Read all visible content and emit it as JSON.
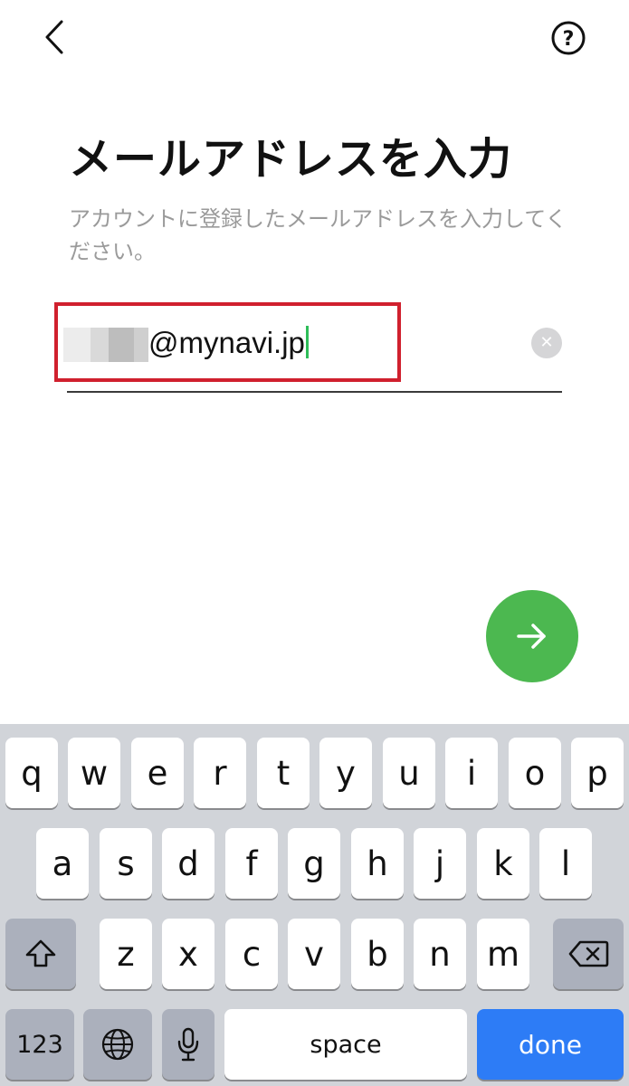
{
  "header": {
    "back_icon": "chevron-left-icon",
    "help_icon": "question-circle-icon",
    "help_glyph": "?"
  },
  "title": "メールアドレスを入力",
  "description": "アカウントに登録したメールアドレスを入力してください。",
  "email": {
    "value": "@mynavi.jp",
    "clear_icon": "clear-icon",
    "clear_glyph": "✕"
  },
  "next_button": {
    "icon": "arrow-right-icon"
  },
  "colors": {
    "accent_green": "#4cb850",
    "caret_green": "#2ebd59",
    "highlight_red": "#d0202e",
    "done_blue": "#2d7cf6",
    "keyboard_bg": "#d1d4d9"
  },
  "keyboard": {
    "row1": [
      "q",
      "w",
      "e",
      "r",
      "t",
      "y",
      "u",
      "i",
      "o",
      "p"
    ],
    "row2": [
      "a",
      "s",
      "d",
      "f",
      "g",
      "h",
      "j",
      "k",
      "l"
    ],
    "row3": [
      "z",
      "x",
      "c",
      "v",
      "b",
      "n",
      "m"
    ],
    "shift_icon": "shift-icon",
    "backspace_icon": "backspace-icon",
    "numbers_label": "123",
    "globe_icon": "globe-icon",
    "mic_icon": "microphone-icon",
    "space_label": "space",
    "done_label": "done"
  }
}
